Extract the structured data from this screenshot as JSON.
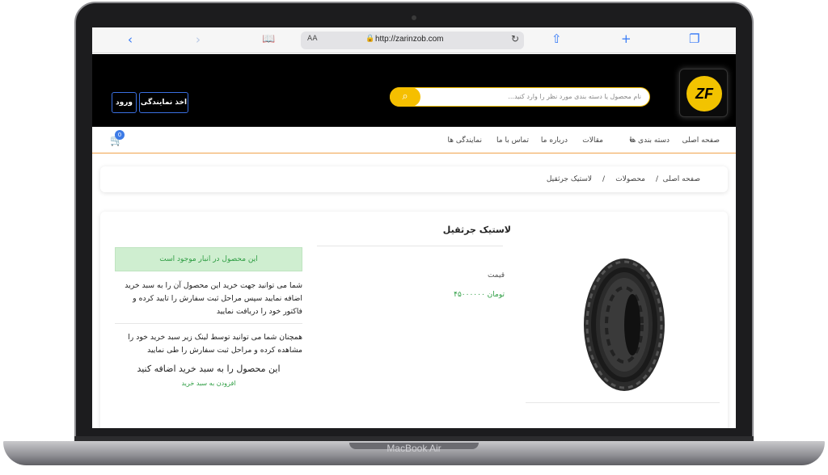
{
  "device": {
    "label": "MacBook Air"
  },
  "browser": {
    "text_size_label": "AA",
    "url": "http://zarinzob.com"
  },
  "site": {
    "logo_text": "ZF",
    "search_placeholder": "نام محصول یا دسته بندی مورد نظر را وارد کنید...",
    "header_buttons": {
      "dealership": "اخذ نمایندگی",
      "login": "ورود"
    },
    "cart_count": "0",
    "nav": [
      {
        "label": "صفحه اصلی"
      },
      {
        "label": "دسته بندی ها"
      },
      {
        "label": "مقالات"
      },
      {
        "label": "درباره ما"
      },
      {
        "label": "تماس با ما"
      },
      {
        "label": "نمایندگی ها"
      }
    ]
  },
  "breadcrumb": {
    "home": "صفحه اصلی",
    "sep": "/",
    "products": "محصولات",
    "current": "لاستیک جرثقیل"
  },
  "product": {
    "title": "لاستیک جرثقیل",
    "price_label": "قیمت",
    "price_value": "۴۵۰۰۰۰۰۰ تومان",
    "stock_status": "این محصول در انبار موجود است",
    "instructions_1": "شما می توانید جهت خرید این محصول آن را به سبد خرید اضافه نمایید سپس مراحل ثبت سفارش را تایید کرده و فاکتور خود را دریافت نمایید",
    "instructions_2": "همچنان شما می توانید توسط لینک زیر سبد خرید خود را مشاهده کرده و مراحل ثبت سفارش را طی نمایید",
    "add_heading": "این محصول را به سبد خرید اضافه کنید",
    "add_link": "افزودن به سبد خرید"
  },
  "colors": {
    "accent": "#f5bf00",
    "success": "#2f9e44",
    "link": "#3478f6",
    "header_bg": "#000000"
  }
}
